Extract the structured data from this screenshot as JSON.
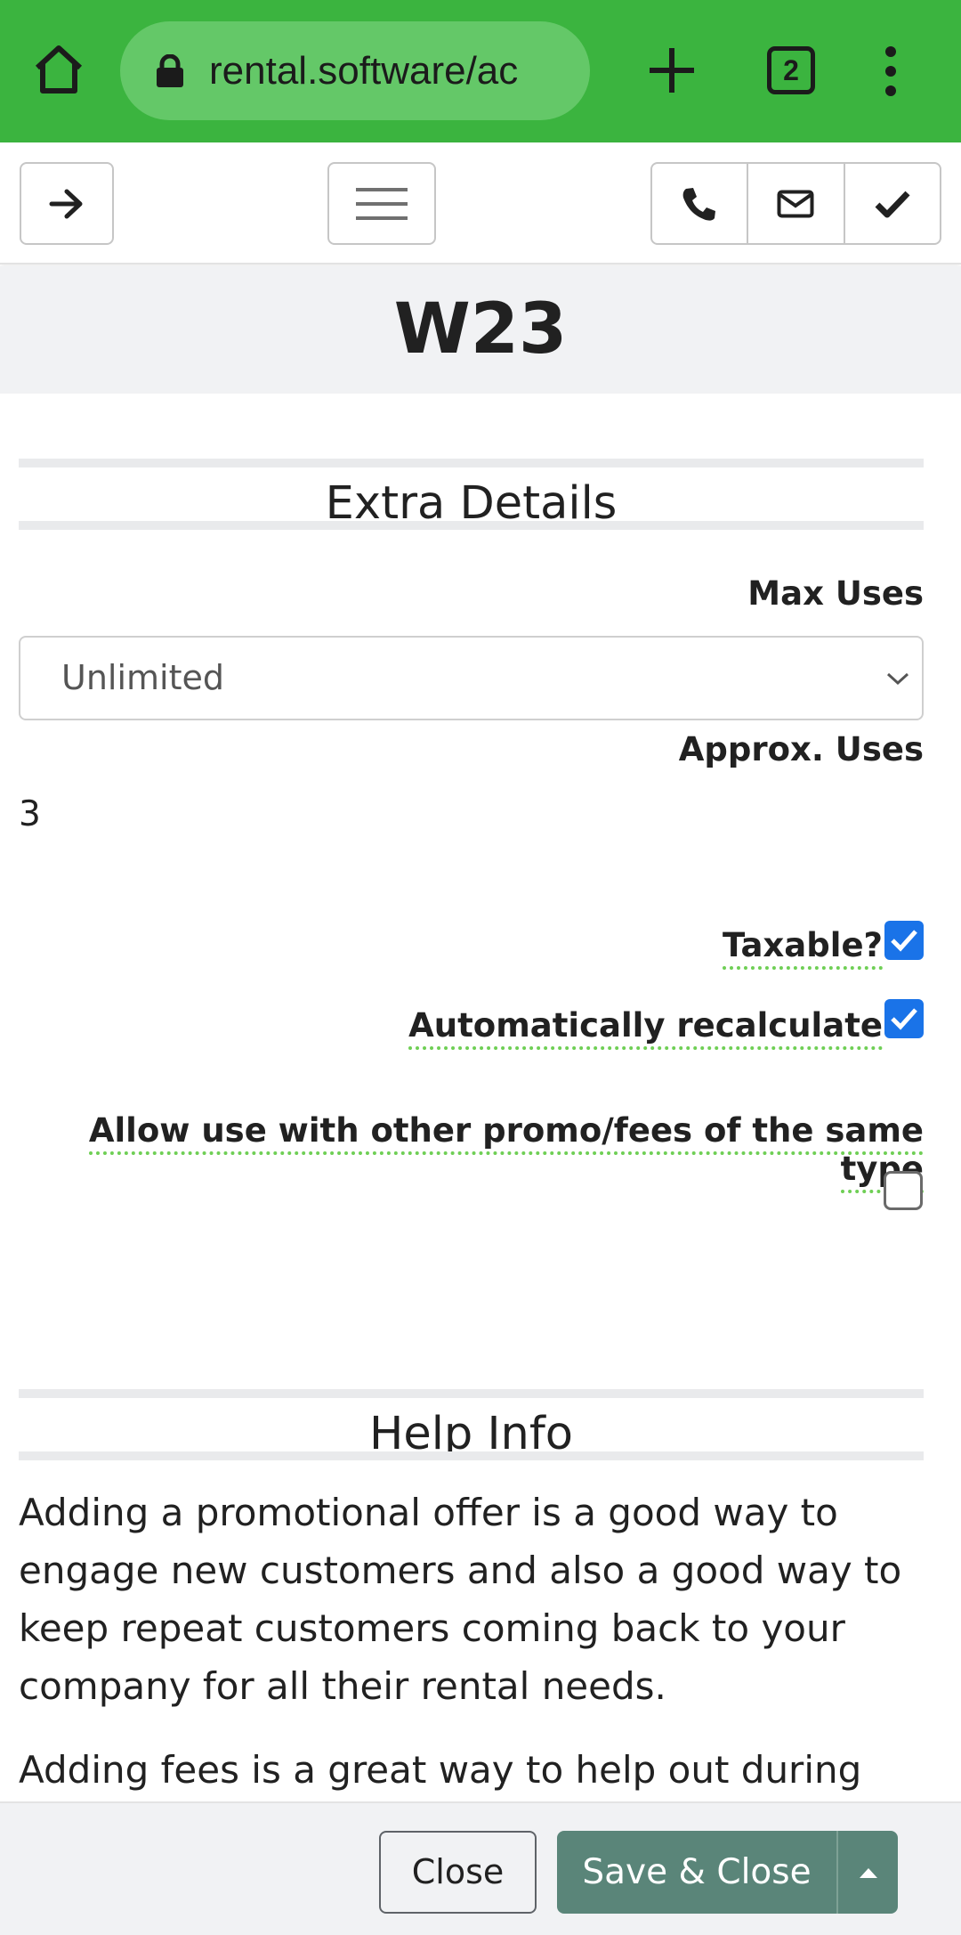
{
  "browser": {
    "url": "rental.software/ac",
    "tab_count": "2",
    "icons": [
      "home-icon",
      "lock-icon",
      "plus-icon",
      "tab-switcher-icon",
      "more-vert-icon"
    ]
  },
  "toolbar": {
    "icons": [
      "arrow-right-icon",
      "hamburger-menu-icon",
      "phone-icon",
      "mail-icon",
      "check-icon"
    ]
  },
  "page": {
    "title": "W23"
  },
  "extra_details": {
    "heading": "Extra Details",
    "max_uses_label": "Max Uses",
    "max_uses_value": "Unlimited",
    "approx_uses_label": "Approx. Uses",
    "approx_uses_value": "3",
    "taxable_label": "Taxable?",
    "taxable_checked": true,
    "auto_recalc_label": "Automatically recalculate",
    "auto_recalc_checked": true,
    "allow_promo_label": "Allow use with other promo/fees of the same type",
    "allow_promo_checked": false
  },
  "help_info": {
    "heading": "Help Info",
    "paragraphs": [
      "Adding a promotional offer is a good way to engage new customers and also a good way to keep repeat customers coming back to your company for all their rental needs.",
      "Adding fees is a great way to help out during"
    ]
  },
  "footer": {
    "close_label": "Close",
    "save_label": "Save & Close"
  },
  "colors": {
    "browser_bar": "#3bb43f",
    "accent_checkbox": "#1a73e8",
    "save_button": "#5a8579"
  }
}
